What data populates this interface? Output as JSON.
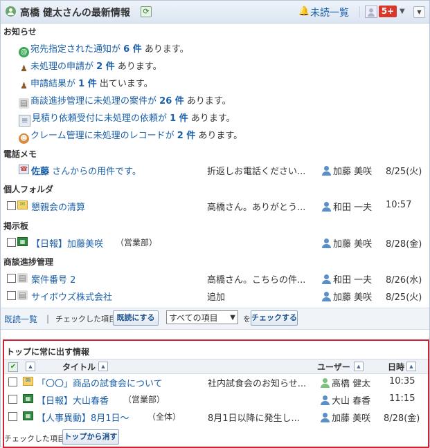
{
  "header": {
    "title": "高橋 健太さんの最新情報",
    "unread_label": "未読一覧",
    "badge": "5+"
  },
  "notices": {
    "heading": "お知らせ",
    "items": [
      {
        "pre": "宛先指定された通知が",
        "count": "6 件",
        "post": "あります。",
        "icon": "at-icon"
      },
      {
        "pre": "未処理の申請が",
        "count": "2 件",
        "post": "あります。",
        "icon": "stamp-icon"
      },
      {
        "pre": "申請結果が",
        "count": "1 件",
        "post": "出ています。",
        "icon": "stamp-icon"
      },
      {
        "pre": "商談進捗管理に未処理の案件が",
        "count": "26 件",
        "post": "あります。",
        "icon": "folder-icon"
      },
      {
        "pre": "見積り依頼受付に未処理の依頼が",
        "count": "1 件",
        "post": "あります。",
        "icon": "document-icon"
      },
      {
        "pre": "クレーム管理に未処理のレコードが",
        "count": "2 件",
        "post": "あります。",
        "icon": "person-icon"
      }
    ]
  },
  "phone_memo": {
    "heading": "電話メモ",
    "rows": [
      {
        "name": "佐藤",
        "suffix": "さんからの用件です。",
        "snippet": "折返しお電話ください...",
        "user": "加藤 美咲",
        "date": "8/25(火)"
      }
    ]
  },
  "personal_folder": {
    "heading": "個人フォルダ",
    "rows": [
      {
        "title": "懇親会の清算",
        "snippet": "高橋さん。ありがとう...",
        "user": "和田 一夫",
        "date": "10:57"
      }
    ]
  },
  "bulletin": {
    "heading": "掲示板",
    "rows": [
      {
        "title": "【日報】加藤美咲",
        "sub": "（営業部）",
        "snippet": "",
        "user": "加藤 美咲",
        "date": "8/28(金)"
      }
    ]
  },
  "deals": {
    "heading": "商談進捗管理",
    "rows": [
      {
        "title": "案件番号 2",
        "snippet": "高橋さん。こちらの件...",
        "user": "和田 一夫",
        "date": "8/26(水)"
      },
      {
        "title": "サイボウズ株式会社",
        "snippet": "追加",
        "user": "加藤 美咲",
        "date": "8/25(火)"
      }
    ]
  },
  "toolbar": {
    "read_list": "既読一覧",
    "bar": "|",
    "checked_text": "チェックした項目を",
    "mark_read_btn": "既読にする",
    "select_value": "すべての項目",
    "wo_text": "を",
    "check_btn": "チェックする"
  },
  "top_box": {
    "title": "トップに常に出す情報",
    "col_title": "タイトル",
    "col_user": "ユーザー",
    "col_date": "日時",
    "rows": [
      {
        "title": "「〇〇」商品の試食会について",
        "sub": "",
        "snippet": "社内試食会のお知らせ...",
        "user": "高橋 健太",
        "date": "10:35",
        "user_color": "green"
      },
      {
        "title": "【日報】大山春香",
        "sub": "（営業部）",
        "snippet": "",
        "user": "大山 春香",
        "date": "11:15",
        "user_color": "blue"
      },
      {
        "title": "【人事異動】8月1日～",
        "sub": "（全体）",
        "snippet": "8月1日以降に発生し...",
        "user": "加藤 美咲",
        "date": "8/28(金)",
        "user_color": "blue"
      }
    ],
    "footer_text": "チェックした項目を",
    "remove_btn": "トップから消す"
  }
}
